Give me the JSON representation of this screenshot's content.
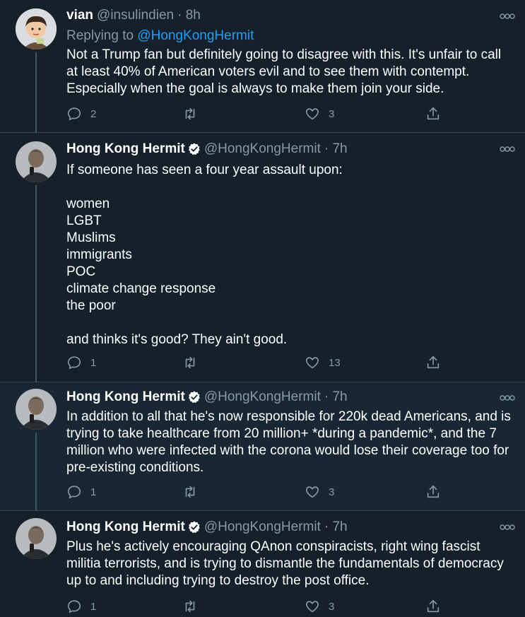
{
  "tweets": [
    {
      "name": "vian",
      "handle": "@insulindien",
      "time": "· 8h",
      "verified": false,
      "replying_prefix": "Replying to",
      "replying_to": "@HongKongHermit",
      "text": "Not a Trump fan but definitely going to disagree with this. It's unfair to call at least 40% of American voters evil and to see them with contempt. Especially when the goal is always to make them join your side.",
      "replies": "2",
      "retweets": "",
      "likes": "3",
      "avatar_icon": "cartoon-avatar"
    },
    {
      "name": "Hong Kong Hermit",
      "handle": "@HongKongHermit",
      "time": "· 7h",
      "verified": true,
      "text": "If someone has seen a four year assault upon:\n\nwomen\nLGBT\nMuslims\nimmigrants\nPOC\nclimate change response\nthe poor\n\nand thinks it's good? They ain't good.",
      "replies": "1",
      "retweets": "",
      "likes": "13",
      "avatar_icon": "photo-avatar"
    },
    {
      "name": "Hong Kong Hermit",
      "handle": "@HongKongHermit",
      "time": "· 7h",
      "verified": true,
      "text": "In addition to all that he's now responsible for 220k dead Americans, and is trying to take healthcare from 20 million+ *during a pandemic*, and the 7 million who were infected with the corona would lose their coverage too for pre-existing conditions.",
      "replies": "1",
      "retweets": "",
      "likes": "3",
      "avatar_icon": "photo-avatar"
    },
    {
      "name": "Hong Kong Hermit",
      "handle": "@HongKongHermit",
      "time": "· 7h",
      "verified": true,
      "text": "Plus he's actively encouraging QAnon conspiracists, right wing fascist militia terrorists, and is trying to dismantle the fundamentals of democracy up to and including trying to destroy the post office.",
      "replies": "1",
      "retweets": "",
      "likes": "3",
      "avatar_icon": "photo-avatar"
    }
  ],
  "colors": {
    "background": "#15202b",
    "background_alt": "#192734",
    "text": "#ffffff",
    "muted": "#8899a6",
    "link": "#1da1f2",
    "verified": "#ffffff"
  }
}
